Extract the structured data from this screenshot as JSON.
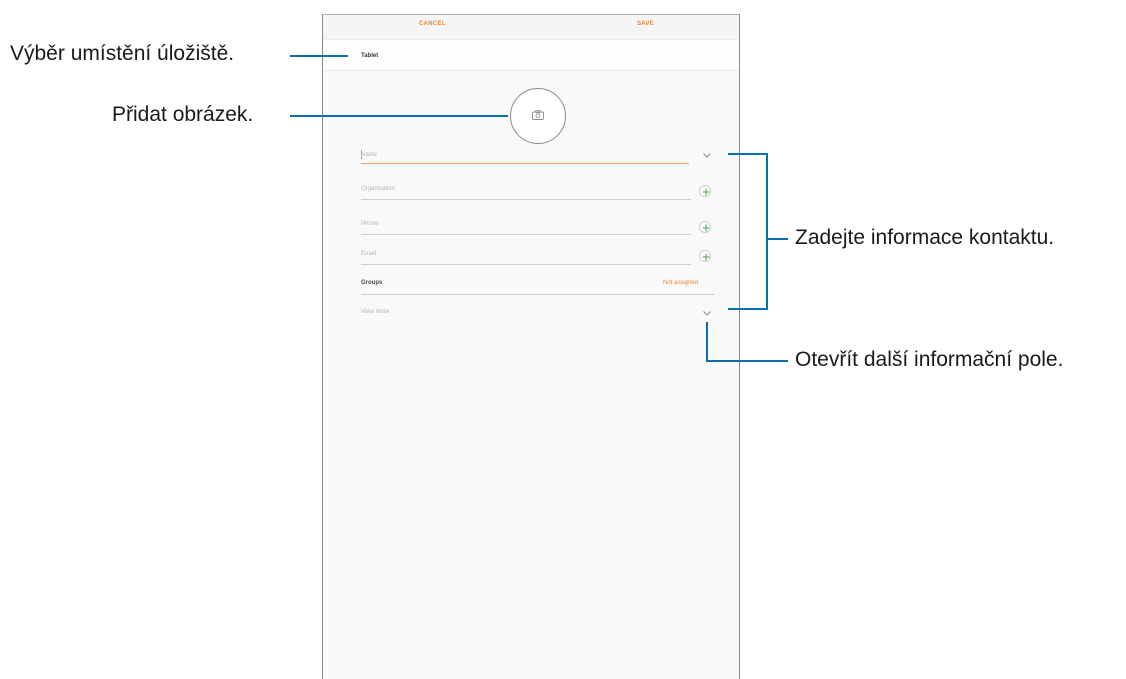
{
  "screen": {
    "actionbar": {
      "cancel_label": "CANCEL",
      "save_label": "SAVE"
    },
    "storage_location": "Tablet",
    "fields": {
      "name_placeholder": "Name",
      "organisation_placeholder": "Organisation",
      "phone_placeholder": "Phone",
      "email_placeholder": "Email"
    },
    "groups": {
      "label": "Groups",
      "value": "Not assigned"
    },
    "view_more": "View more",
    "icons": [
      "camera-icon",
      "plus-icon",
      "chevron-down-icon"
    ],
    "colors": {
      "accent": "#e8873a",
      "add": "#4caf50",
      "callout_line": "#0d6fa8"
    }
  },
  "callouts": {
    "storage": "Výběr umístění úložiště.",
    "picture": "Přidat obrázek.",
    "contact_info": "Zadejte informace kontaktu.",
    "more_fields": "Otevřít další informační pole."
  }
}
